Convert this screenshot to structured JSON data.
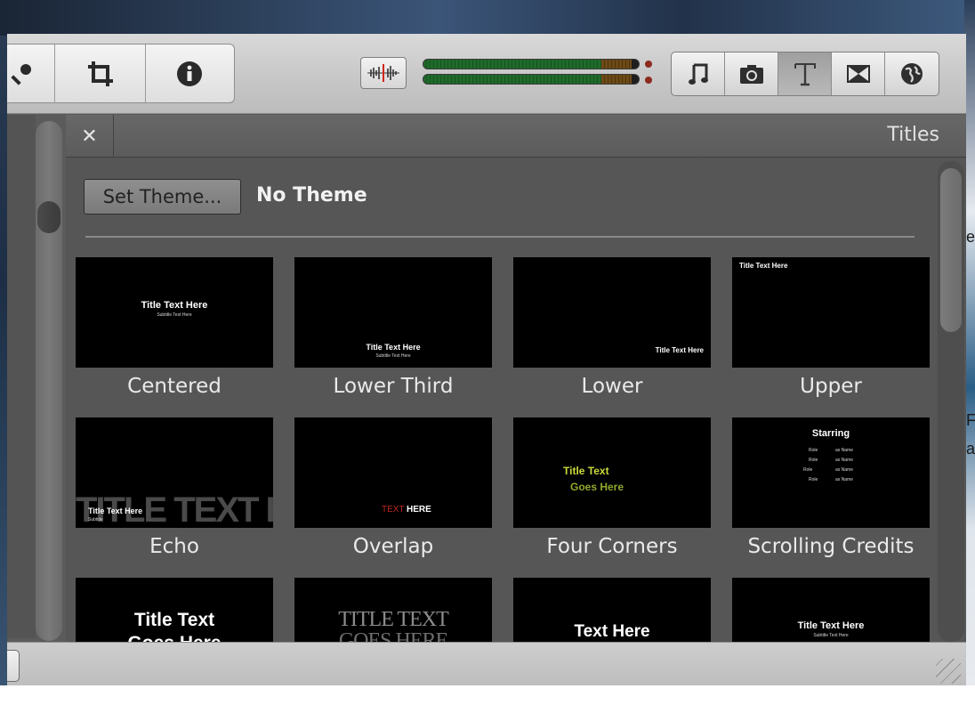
{
  "toolbar": {
    "tools": [
      {
        "name": "voiceover",
        "icon": "microphone-icon"
      },
      {
        "name": "crop",
        "icon": "crop-icon"
      },
      {
        "name": "info",
        "icon": "info-icon"
      }
    ],
    "audio_button_icon": "waveform-icon",
    "meter_levels": {
      "left": 0.86,
      "right": 0.86
    },
    "browsers": [
      {
        "name": "music",
        "icon": "music-note-icon",
        "active": false
      },
      {
        "name": "photos",
        "icon": "camera-icon",
        "active": false
      },
      {
        "name": "titles",
        "icon": "text-t-icon",
        "active": true
      },
      {
        "name": "transitions",
        "icon": "transition-icon",
        "active": false
      },
      {
        "name": "maps",
        "icon": "globe-icon",
        "active": false
      }
    ]
  },
  "panel": {
    "close_glyph": "✕",
    "title": "Titles",
    "set_theme_label": "Set Theme...",
    "current_theme": "No Theme"
  },
  "tiles": [
    {
      "caption": "Centered",
      "title": "Title Text Here",
      "subtitle": "Subtitle Text Here"
    },
    {
      "caption": "Lower Third",
      "title": "Title Text Here",
      "subtitle": "Subtitle Text Here"
    },
    {
      "caption": "Lower",
      "title": "Title Text Here"
    },
    {
      "caption": "Upper",
      "title": "Title Text Here"
    },
    {
      "caption": "Echo",
      "title": "TITLE TEXT HERE",
      "small": "Title Text Here",
      "small_sub": "Subtitle"
    },
    {
      "caption": "Overlap",
      "title_a": "TEXT",
      "title_b": "HERE"
    },
    {
      "caption": "Four Corners",
      "title": "Title Text",
      "title2": "Goes Here"
    },
    {
      "caption": "Scrolling Credits",
      "title": "Starring",
      "rows": [
        [
          "Role",
          "as Name"
        ],
        [
          "Role",
          "as Name"
        ],
        [
          "Role",
          "as Name"
        ],
        [
          "Role",
          "as Name"
        ]
      ]
    },
    {
      "caption": "",
      "title": "Title Text",
      "title2": "Goes Here"
    },
    {
      "caption": "",
      "title": "TITLE TEXT",
      "title2": "GOES HERE"
    },
    {
      "caption": "",
      "title": "Text Here"
    },
    {
      "caption": "",
      "title": "Title Text Here",
      "subtitle": "Subtitle Text Here"
    }
  ],
  "colors": {
    "panel_bg": "#565656",
    "toolbar_bg": "#c9c9c9",
    "meter_green": "#1f6b2a",
    "overlap_red": "#c0261c",
    "four_corners_green": "#b7c93a"
  },
  "desktop_fragments": [
    "e",
    "F",
    "a"
  ]
}
